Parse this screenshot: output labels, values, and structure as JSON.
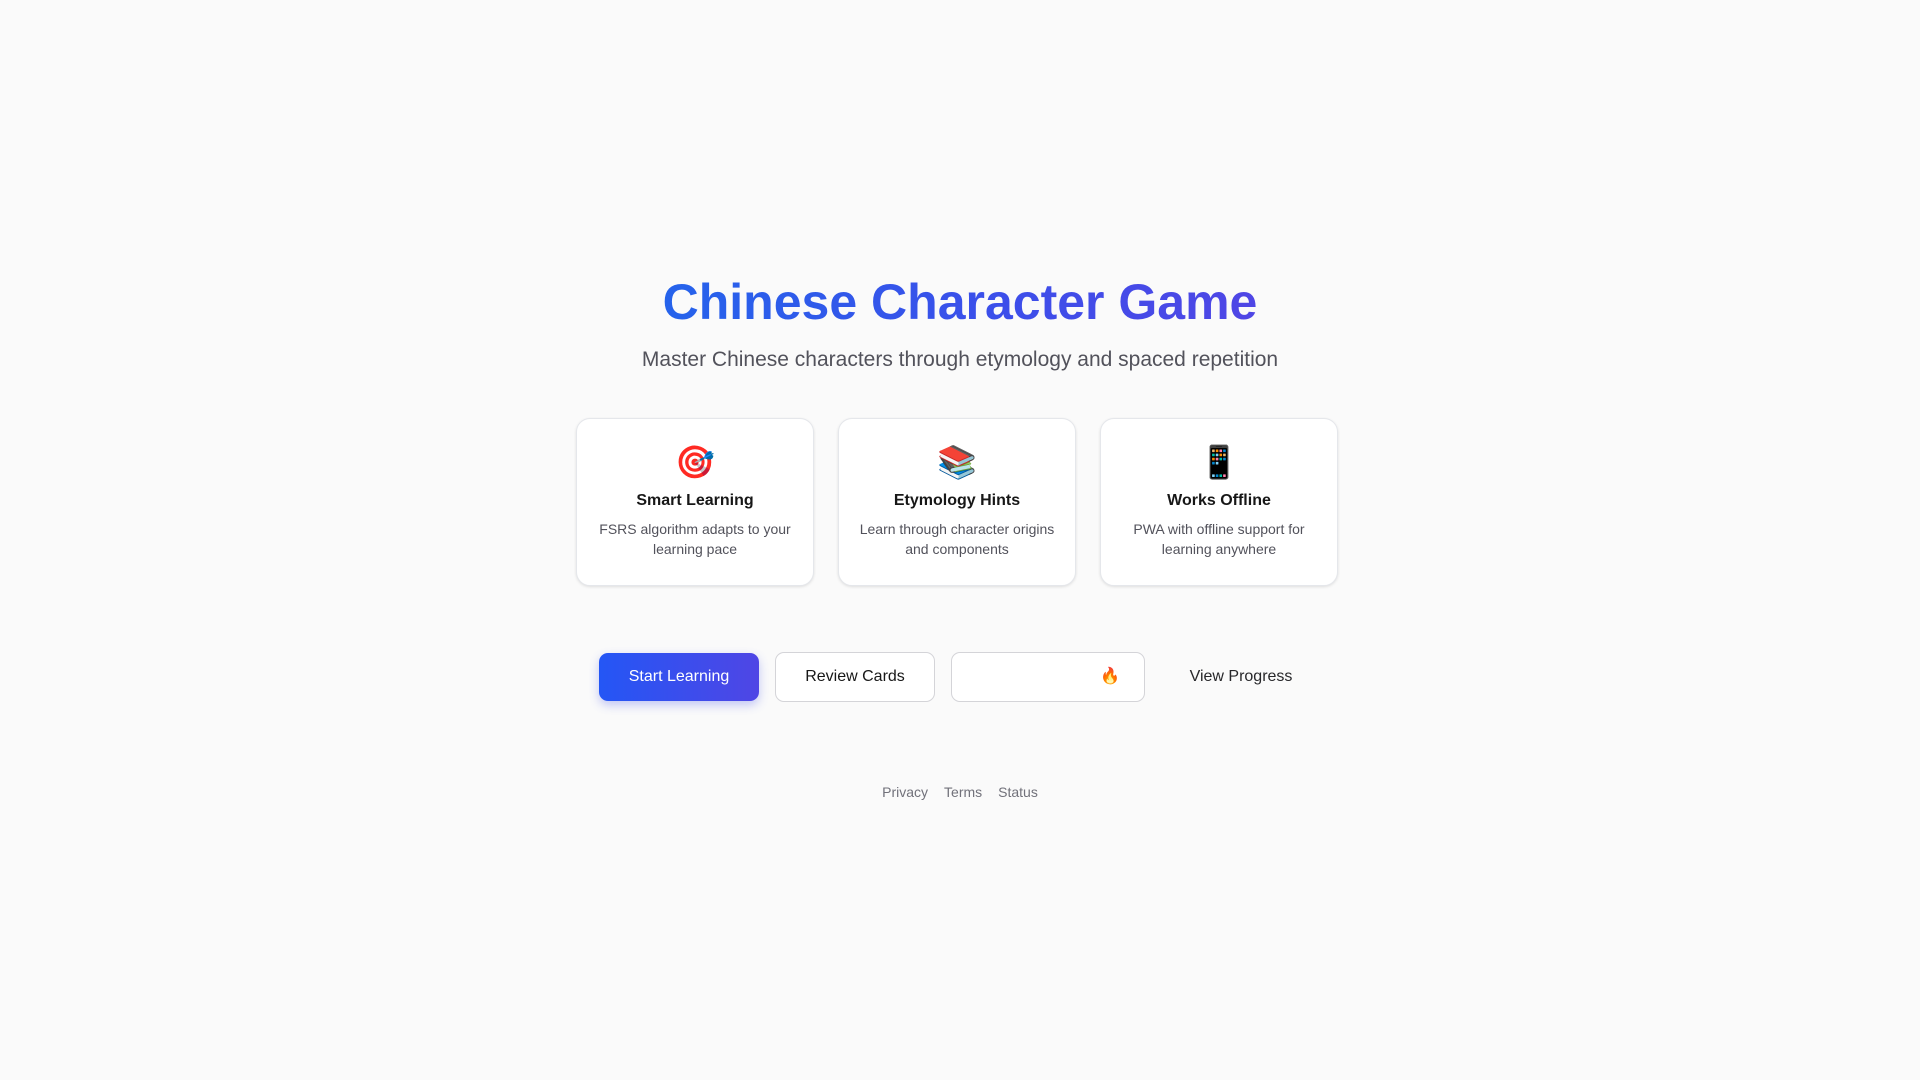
{
  "hero": {
    "title": "Chinese Character Game",
    "subtitle": "Master Chinese characters through etymology and spaced repetition"
  },
  "features": [
    {
      "icon": "target-icon",
      "glyph": "🎯",
      "title": "Smart Learning",
      "description": "FSRS algorithm adapts to your learning pace"
    },
    {
      "icon": "books-icon",
      "glyph": "📚",
      "title": "Etymology Hints",
      "description": "Learn through character origins and components"
    },
    {
      "icon": "mobile-phone-icon",
      "glyph": "📱",
      "title": "Works Offline",
      "description": "PWA with offline support for learning anywhere"
    }
  ],
  "actions": {
    "start_label": "Start Learning",
    "review_label": "Review Cards",
    "streak_icon": "fire-icon",
    "streak_glyph": "🔥",
    "progress_label": "View Progress"
  },
  "footer": {
    "links": [
      "Privacy",
      "Terms",
      "Status"
    ]
  },
  "colors": {
    "accent_start": "#2563eb",
    "accent_end": "#4f46e5",
    "background": "#fafafa"
  }
}
